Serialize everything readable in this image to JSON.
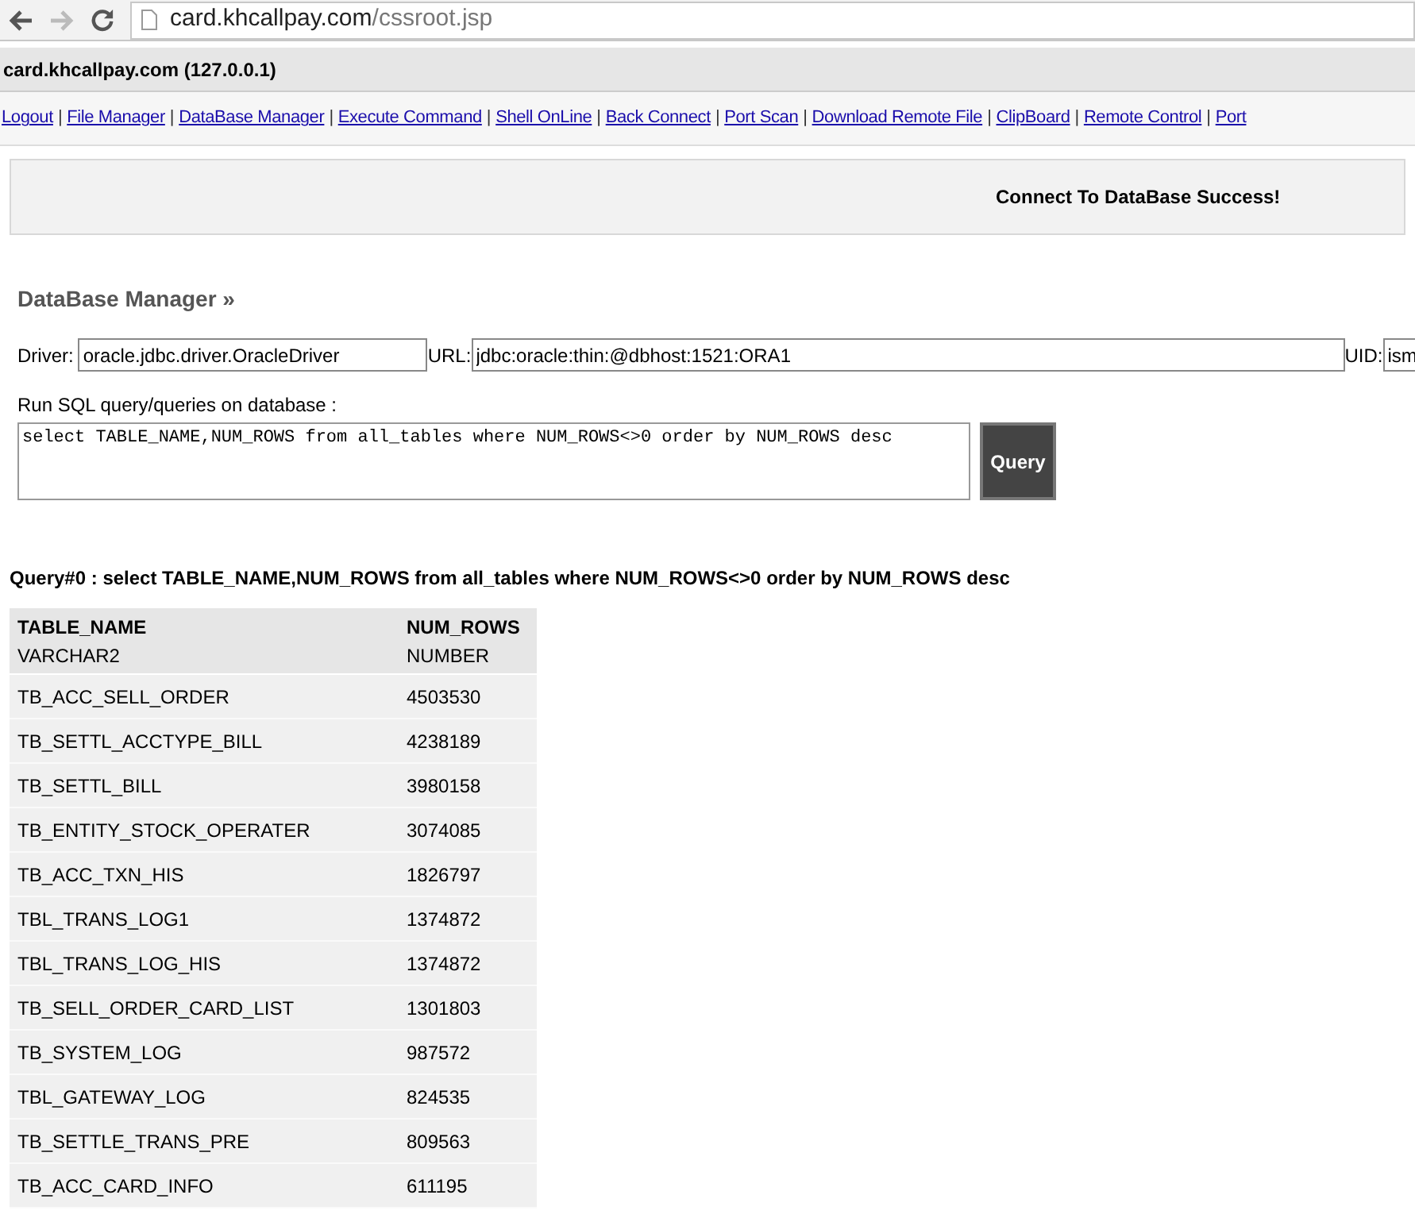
{
  "browser": {
    "url_host": "card.khcallpay.com",
    "url_path": "/cssroot.jsp"
  },
  "host_bar": {
    "title": "card.khcallpay.com (127.0.0.1)"
  },
  "nav": [
    {
      "kind": "link",
      "text": "Logout"
    },
    {
      "kind": "separator",
      "text": "|"
    },
    {
      "kind": "link",
      "text": "File Manager"
    },
    {
      "kind": "separator",
      "text": "|"
    },
    {
      "kind": "link",
      "text": "DataBase Manager"
    },
    {
      "kind": "separator",
      "text": "|"
    },
    {
      "kind": "link",
      "text": "Execute Command"
    },
    {
      "kind": "separator",
      "text": "|"
    },
    {
      "kind": "link",
      "text": "Shell OnLine"
    },
    {
      "kind": "separator",
      "text": "|"
    },
    {
      "kind": "link",
      "text": "Back Connect"
    },
    {
      "kind": "separator",
      "text": "|"
    },
    {
      "kind": "link",
      "text": "Port Scan"
    },
    {
      "kind": "separator",
      "text": "|"
    },
    {
      "kind": "link",
      "text": "Download Remote File"
    },
    {
      "kind": "separator",
      "text": "|"
    },
    {
      "kind": "link",
      "text": "ClipBoard"
    },
    {
      "kind": "separator",
      "text": "|"
    },
    {
      "kind": "link",
      "text": "Remote Control"
    },
    {
      "kind": "separator",
      "text": "|"
    },
    {
      "kind": "link",
      "text": "Port"
    }
  ],
  "message": "Connect To DataBase Success!",
  "section_title": "DataBase Manager »",
  "fields": [
    {
      "label": "Driver:",
      "value": "oracle.jdbc.driver.OracleDriver"
    },
    {
      "label": "URL:",
      "value": "jdbc:oracle:thin:@dbhost:1521:ORA1"
    },
    {
      "label": "UID:",
      "value": "ism"
    }
  ],
  "sql": {
    "label": "Run SQL query/queries on database :",
    "value": "select TABLE_NAME,NUM_ROWS from all_tables where NUM_ROWS<>0 order by NUM_ROWS desc",
    "button": "Query"
  },
  "result": {
    "title": "Query#0 : select TABLE_NAME,NUM_ROWS from all_tables where NUM_ROWS<>0 order by NUM_ROWS desc",
    "columns": [
      {
        "name": "TABLE_NAME",
        "type": "VARCHAR2"
      },
      {
        "name": "NUM_ROWS",
        "type": "NUMBER"
      }
    ],
    "rows": [
      [
        "TB_ACC_SELL_ORDER",
        "4503530"
      ],
      [
        "TB_SETTL_ACCTYPE_BILL",
        "4238189"
      ],
      [
        "TB_SETTL_BILL",
        "3980158"
      ],
      [
        "TB_ENTITY_STOCK_OPERATER",
        "3074085"
      ],
      [
        "TB_ACC_TXN_HIS",
        "1826797"
      ],
      [
        "TBL_TRANS_LOG1",
        "1374872"
      ],
      [
        "TBL_TRANS_LOG_HIS",
        "1374872"
      ],
      [
        "TB_SELL_ORDER_CARD_LIST",
        "1301803"
      ],
      [
        "TB_SYSTEM_LOG",
        "987572"
      ],
      [
        "TBL_GATEWAY_LOG",
        "824535"
      ],
      [
        "TB_SETTLE_TRANS_PRE",
        "809563"
      ],
      [
        "TB_ACC_CARD_INFO",
        "611195"
      ]
    ]
  }
}
